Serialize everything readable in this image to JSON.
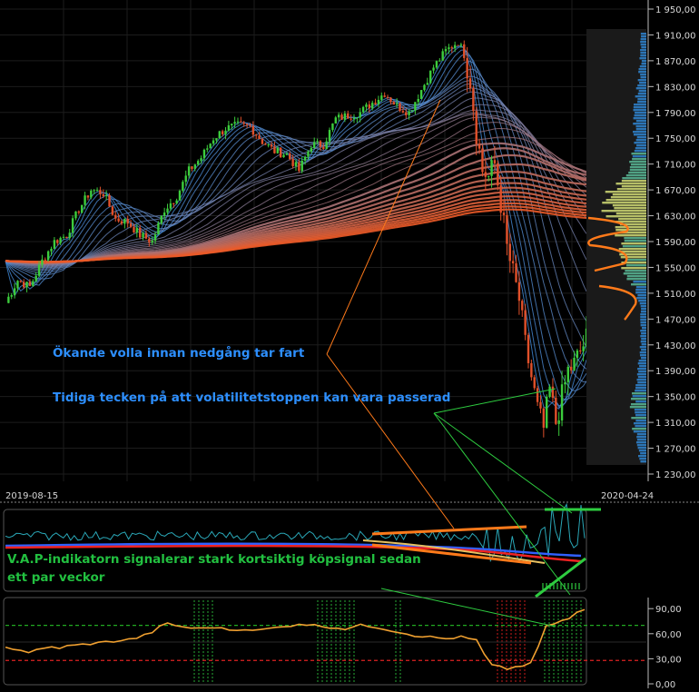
{
  "chart_data": [
    {
      "type": "candlestick",
      "y_ticks": [
        "1 950,00",
        "1 910,00",
        "1 870,00",
        "1 830,00",
        "1 790,00",
        "1 750,00",
        "1 710,00",
        "1 670,00",
        "1 630,00",
        "1 590,00",
        "1 550,00",
        "1 510,00",
        "1 470,00",
        "1 430,00",
        "1 390,00",
        "1 350,00",
        "1 310,00",
        "1 270,00",
        "1 230,00"
      ],
      "ylim": [
        1230,
        1950
      ],
      "x_start_label": "2019-08-15",
      "x_end_label": "2020-04-24",
      "close_path": [
        [
          0,
          1495
        ],
        [
          4,
          1530
        ],
        [
          8,
          1520
        ],
        [
          12,
          1560
        ],
        [
          16,
          1590
        ],
        [
          20,
          1600
        ],
        [
          24,
          1640
        ],
        [
          28,
          1670
        ],
        [
          32,
          1665
        ],
        [
          36,
          1625
        ],
        [
          40,
          1620
        ],
        [
          44,
          1600
        ],
        [
          48,
          1590
        ],
        [
          52,
          1640
        ],
        [
          56,
          1660
        ],
        [
          60,
          1700
        ],
        [
          64,
          1720
        ],
        [
          68,
          1750
        ],
        [
          72,
          1765
        ],
        [
          76,
          1770
        ],
        [
          80,
          1768
        ],
        [
          84,
          1745
        ],
        [
          88,
          1730
        ],
        [
          92,
          1725
        ],
        [
          96,
          1700
        ],
        [
          100,
          1740
        ],
        [
          104,
          1740
        ],
        [
          108,
          1780
        ],
        [
          112,
          1785
        ],
        [
          116,
          1790
        ],
        [
          120,
          1805
        ],
        [
          124,
          1820
        ],
        [
          128,
          1800
        ],
        [
          132,
          1790
        ],
        [
          136,
          1825
        ],
        [
          140,
          1860
        ],
        [
          144,
          1885
        ],
        [
          148,
          1900
        ],
        [
          150,
          1880
        ],
        [
          152,
          1840
        ],
        [
          154,
          1760
        ],
        [
          156,
          1700
        ],
        [
          158,
          1690
        ],
        [
          160,
          1710
        ],
        [
          162,
          1650
        ],
        [
          164,
          1580
        ],
        [
          166,
          1540
        ],
        [
          168,
          1500
        ],
        [
          170,
          1430
        ],
        [
          172,
          1380
        ],
        [
          174,
          1330
        ],
        [
          176,
          1300
        ],
        [
          178,
          1360
        ],
        [
          180,
          1310
        ],
        [
          182,
          1350
        ],
        [
          184,
          1390
        ],
        [
          186,
          1400
        ],
        [
          188,
          1420
        ],
        [
          190,
          1440
        ]
      ],
      "annotations": [
        "Ökande volla innan nedgång tar fart",
        "Tidiga tecken på att volatilitetstoppen kan vara passerad"
      ],
      "volume_profile": "horizontal volume-at-price histogram on right side"
    },
    {
      "type": "line",
      "annotation": "V.A.P-indikatorn signalerar stark kortsiktig köpsignal sedan ett par veckor"
    },
    {
      "type": "line",
      "y_ticks": [
        "90,00",
        "60,00",
        "30,00",
        "0,00"
      ],
      "ylim": [
        0,
        100
      ],
      "levels": [
        {
          "value": 70,
          "color": "#22aa22"
        },
        {
          "value": 28,
          "color": "#dd2222"
        }
      ],
      "values": [
        45,
        42,
        40,
        38,
        40,
        42,
        44,
        43,
        45,
        46,
        47,
        48,
        49,
        50,
        51,
        52,
        53,
        55,
        58,
        62,
        68,
        72,
        70,
        68,
        67,
        66,
        67,
        68,
        66,
        65,
        64,
        66,
        65,
        64,
        66,
        67,
        68,
        70,
        72,
        71,
        70,
        69,
        68,
        67,
        66,
        68,
        70,
        69,
        68,
        66,
        64,
        62,
        60,
        58,
        57,
        56,
        55,
        54,
        55,
        56,
        54,
        52,
        35,
        22,
        20,
        18,
        20,
        22,
        24,
        45,
        68,
        72,
        75,
        78,
        85,
        88
      ]
    }
  ],
  "colors": {
    "bg": "#000000",
    "grid": "#1c1c1c",
    "axis_text": "#d8d8d8",
    "annot_blue": "#2d8fff",
    "annot_green": "#22c040",
    "orange": "#ff7a1a",
    "up_candle": "#3ccc3c",
    "down_candle": "#e0502a"
  }
}
